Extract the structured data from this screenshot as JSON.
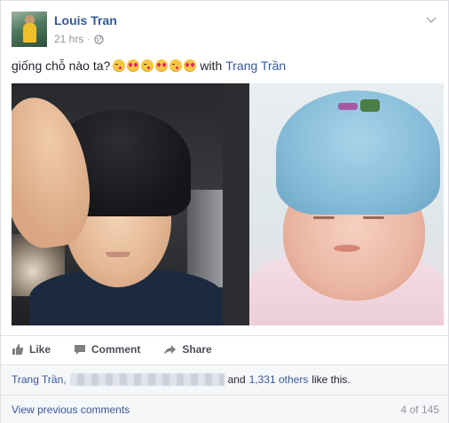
{
  "post": {
    "author": "Louis Tran",
    "time": "21 hrs",
    "time_separator": "·",
    "privacy_icon": "globe-icon",
    "message_text": "giống chỗ nào ta?",
    "emojis": [
      "kiss-emoji",
      "heart-eyes-emoji",
      "kiss-emoji",
      "heart-eyes-emoji",
      "kiss-emoji",
      "heart-eyes-emoji"
    ],
    "with_label": "with",
    "tagged_user": "Trang Trần"
  },
  "actions": {
    "like": "Like",
    "comment": "Comment",
    "share": "Share"
  },
  "likes": {
    "first_name": "Trang Trần,",
    "and_label": "and",
    "others_link": "1,331 others",
    "suffix": "like this."
  },
  "comments": {
    "view_previous": "View previous comments",
    "count": "4 of 145"
  },
  "colors": {
    "link": "#365899",
    "secondary_text": "#90949c",
    "footer_bg": "#f6f7f9"
  }
}
